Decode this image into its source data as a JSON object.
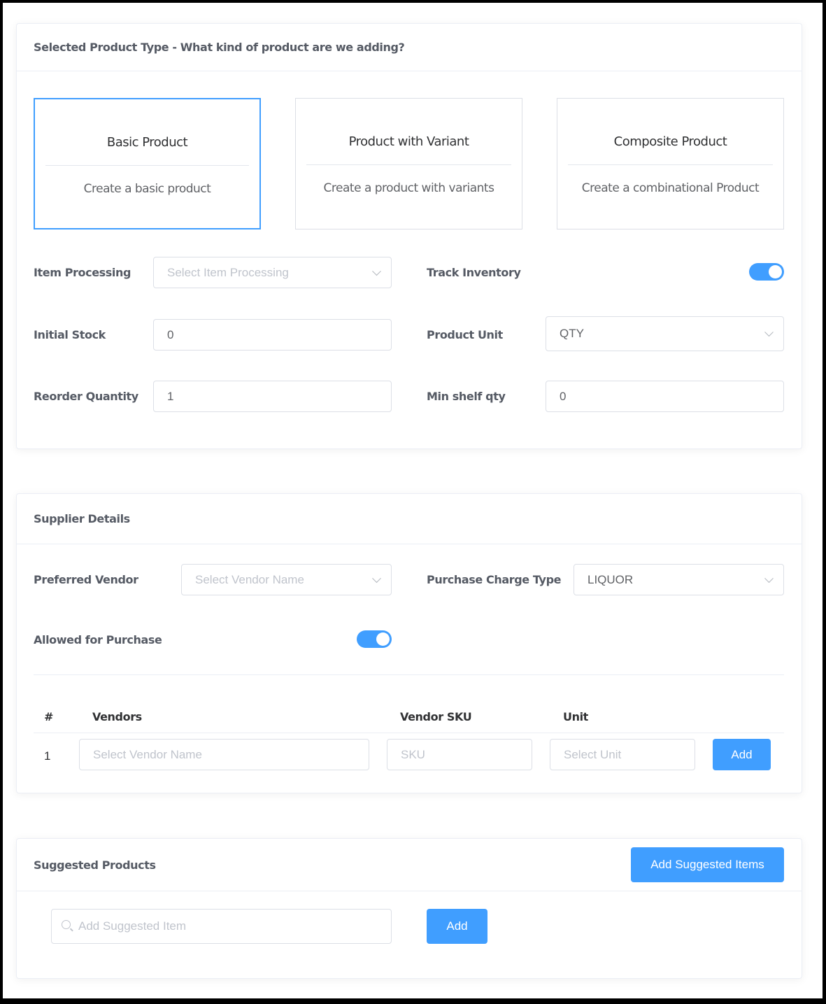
{
  "product_type": {
    "title": "Selected Product Type - What kind of product are we adding?",
    "options": [
      {
        "title": "Basic Product",
        "description": "Create a basic product",
        "selected": true
      },
      {
        "title": "Product with Variant",
        "description": "Create a product with variants",
        "selected": false
      },
      {
        "title": "Composite Product",
        "description": "Create a combinational Product",
        "selected": false
      }
    ],
    "fields": {
      "item_processing": {
        "label": "Item Processing",
        "placeholder": "Select Item Processing",
        "value": ""
      },
      "track_inventory": {
        "label": "Track Inventory",
        "enabled": true
      },
      "initial_stock": {
        "label": "Initial Stock",
        "value": "0"
      },
      "product_unit": {
        "label": "Product Unit",
        "value": "QTY"
      },
      "reorder_quantity": {
        "label": "Reorder Quantity",
        "value": "1"
      },
      "min_shelf_qty": {
        "label": "Min shelf qty",
        "value": "0"
      }
    }
  },
  "supplier": {
    "title": "Supplier Details",
    "preferred_vendor": {
      "label": "Preferred Vendor",
      "placeholder": "Select Vendor Name"
    },
    "purchase_charge_type": {
      "label": "Purchase Charge Type",
      "value": "LIQUOR"
    },
    "allowed_for_purchase": {
      "label": "Allowed for Purchase",
      "enabled": true
    },
    "table": {
      "columns": [
        "#",
        "Vendors",
        "Vendor SKU",
        "Unit"
      ],
      "rows": [
        {
          "index": "1",
          "vendor_placeholder": "Select Vendor Name",
          "sku_placeholder": "SKU",
          "unit_placeholder": "Select Unit",
          "action_label": "Add"
        }
      ]
    }
  },
  "suggested": {
    "title": "Suggested Products",
    "add_suggested_items_label": "Add Suggested Items",
    "search_placeholder": "Add Suggested Item",
    "add_label": "Add"
  },
  "colors": {
    "accent": "#409eff",
    "label": "#555a64",
    "border": "#dcdfe6",
    "placeholder": "#c0c4cc"
  }
}
